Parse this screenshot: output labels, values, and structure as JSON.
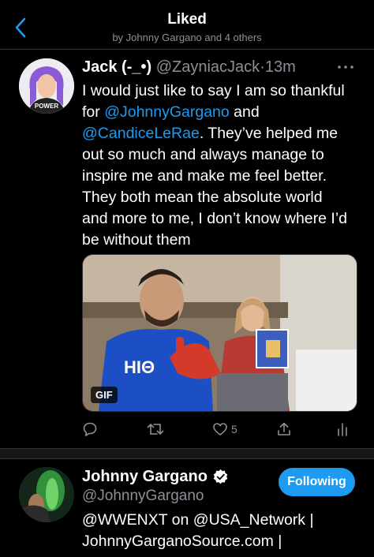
{
  "header": {
    "title": "Liked",
    "subtitle": "by Johnny Gargano and 4 others"
  },
  "tweet": {
    "author_name": "Jack (-_•)",
    "handle": "@ZayniacJack",
    "separator": "·",
    "time": "13m",
    "text_1": "I would just like to say I am so thankful for ",
    "mention_1": "@JohnnyGargano",
    "text_2": " and ",
    "mention_2": "@CandiceLeRae",
    "text_3": ". They’ve helped me out so much and always manage to inspire me and make me feel better. They both mean the absolute world and more to me, I don’t know where I’d be without them",
    "avatar_text": "POWER",
    "media_badge": "GIF",
    "shirt_text": "HΙΘ",
    "like_count": "5",
    "icons": [
      "reply-icon",
      "retweet-icon",
      "like-icon",
      "share-icon",
      "analytics-icon"
    ]
  },
  "user": {
    "name": "Johnny Gargano",
    "handle": "@JohnnyGargano",
    "follow_label": "Following",
    "bio_1": "@WWENXT on @USA_Network |",
    "bio_2": "JohnnyGarganoSource.com |"
  },
  "colors": {
    "accent": "#1d9bf0",
    "background": "#000000",
    "secondary_text": "#8b9096"
  }
}
